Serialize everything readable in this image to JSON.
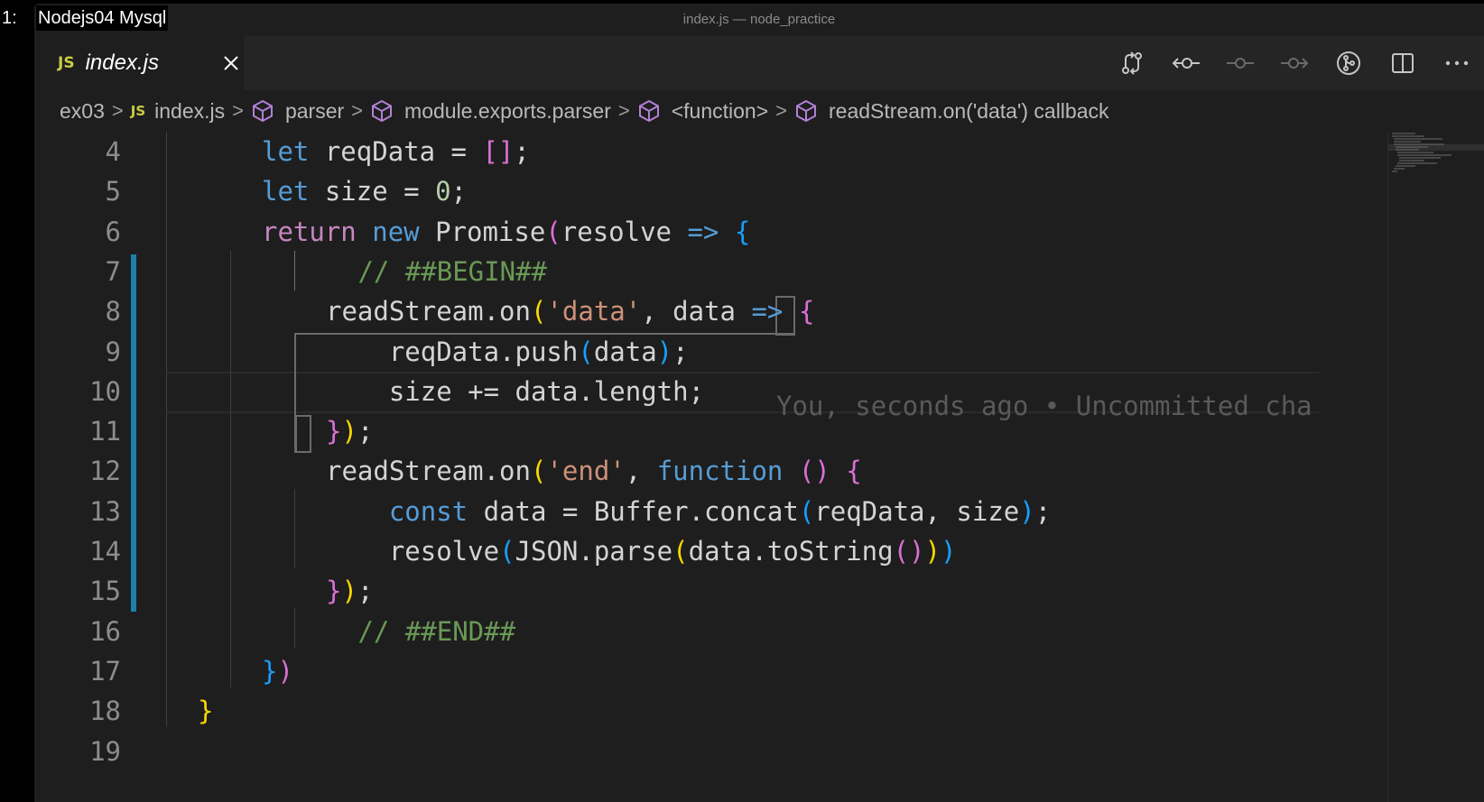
{
  "overlay": {
    "label": "1:",
    "title": "Nodejs04 Mysql"
  },
  "window": {
    "title": "index.js — node_practice"
  },
  "tab": {
    "lang_badge": "JS",
    "filename": "index.js"
  },
  "toolbar": {
    "icons": [
      "compare-changes-icon",
      "git-prev-change-icon",
      "git-commit-icon",
      "git-next-change-icon",
      "git-lens-icon",
      "split-editor-icon",
      "more-actions-icon"
    ]
  },
  "breadcrumb": {
    "items": [
      "ex03",
      "index.js",
      "parser",
      "module.exports.parser",
      "<function>",
      "readStream.on('data') callback"
    ]
  },
  "editor": {
    "line_numbers": [
      "4",
      "5",
      "6",
      "7",
      "8",
      "9",
      "10",
      "11",
      "12",
      "13",
      "14",
      "15",
      "16",
      "17",
      "18",
      "19"
    ],
    "blame": "You, seconds ago • Uncommitted cha",
    "colors": {
      "keyword": "#569cd6",
      "string": "#ce9178",
      "comment": "#6a9955",
      "number": "#b5cea8",
      "modified_gutter": "#1b81a8"
    },
    "lines": [
      [
        [
          "kw",
          "let"
        ],
        [
          "var",
          " reqData = "
        ],
        [
          "b2",
          "[]"
        ],
        [
          "var",
          ";"
        ]
      ],
      [
        [
          "kw",
          "let"
        ],
        [
          "var",
          " size = "
        ],
        [
          "num",
          "0"
        ],
        [
          "var",
          ";"
        ]
      ],
      [
        [
          "ctl",
          "return"
        ],
        [
          "var",
          " "
        ],
        [
          "kw",
          "new"
        ],
        [
          "var",
          " Promise"
        ],
        [
          "b2",
          "("
        ],
        [
          "var",
          "resolve "
        ],
        [
          "kw",
          "=>"
        ],
        [
          "var",
          " "
        ],
        [
          "b3",
          "{"
        ]
      ],
      [
        [
          "var",
          " "
        ],
        [
          "cmt",
          "// ##BEGIN##"
        ]
      ],
      [
        [
          "var",
          "readStream.on"
        ],
        [
          "b1",
          "("
        ],
        [
          "str",
          "'data'"
        ],
        [
          "var",
          ", data "
        ],
        [
          "kw",
          "=>"
        ],
        [
          "var",
          " "
        ],
        [
          "b2",
          "{"
        ]
      ],
      [
        [
          "var",
          "    reqData.push"
        ],
        [
          "b3",
          "("
        ],
        [
          "var",
          "data"
        ],
        [
          "b3",
          ")"
        ],
        [
          "var",
          ";"
        ]
      ],
      [
        [
          "var",
          "    size += data.length;"
        ]
      ],
      [
        [
          "b2",
          "}"
        ],
        [
          "b1",
          ")"
        ],
        [
          "var",
          ";"
        ]
      ],
      [
        [
          "var",
          "readStream.on"
        ],
        [
          "b1",
          "("
        ],
        [
          "str",
          "'end'"
        ],
        [
          "var",
          ", "
        ],
        [
          "kw",
          "function"
        ],
        [
          "var",
          " "
        ],
        [
          "b2",
          "()"
        ],
        [
          "var",
          " "
        ],
        [
          "b2",
          "{"
        ]
      ],
      [
        [
          "var",
          "    "
        ],
        [
          "kw",
          "const"
        ],
        [
          "var",
          " data = Buffer.concat"
        ],
        [
          "b3",
          "("
        ],
        [
          "var",
          "reqData, size"
        ],
        [
          "b3",
          ")"
        ],
        [
          "var",
          ";"
        ]
      ],
      [
        [
          "var",
          "    resolve"
        ],
        [
          "b3",
          "("
        ],
        [
          "var",
          "JSON.parse"
        ],
        [
          "b1",
          "("
        ],
        [
          "var",
          "data.toString"
        ],
        [
          "b2",
          "()"
        ],
        [
          "b1",
          ")"
        ],
        [
          "b3",
          ")"
        ]
      ],
      [
        [
          "b2",
          "}"
        ],
        [
          "b1",
          ")"
        ],
        [
          "var",
          ";"
        ]
      ],
      [
        [
          "var",
          " "
        ],
        [
          "cmt",
          "// ##END##"
        ]
      ],
      [
        [
          "b3",
          "}"
        ],
        [
          "b2",
          ")"
        ]
      ],
      [
        [
          "b1",
          "}"
        ]
      ],
      []
    ]
  }
}
